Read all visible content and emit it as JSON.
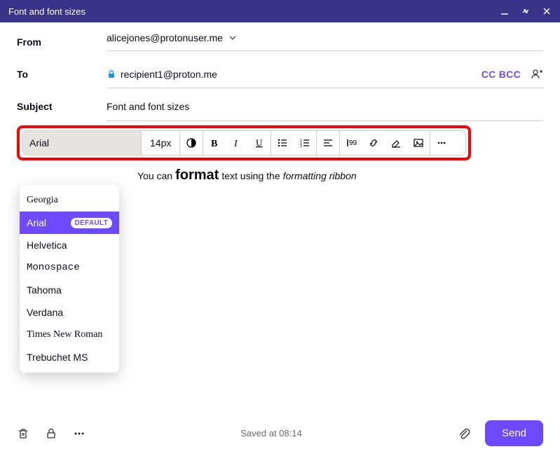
{
  "window": {
    "title": "Font and font sizes"
  },
  "fields": {
    "from": {
      "label": "From",
      "value": "alicejones@protonuser.me"
    },
    "to": {
      "label": "To",
      "value": "recipient1@proton.me",
      "cc_bcc": "CC BCC"
    },
    "subject": {
      "label": "Subject",
      "value": "Font and font sizes"
    }
  },
  "toolbar": {
    "font": "Arial",
    "size": "14px"
  },
  "body": {
    "part1": "You can ",
    "bold": "format",
    "part2": " text using the ",
    "italic": "formatting ribbon"
  },
  "font_dropdown": {
    "default_badge": "DEFAULT",
    "items": [
      {
        "label": "Georgia",
        "css": "font-georgia",
        "selected": false
      },
      {
        "label": "Arial",
        "css": "font-arial",
        "selected": true,
        "default": true
      },
      {
        "label": "Helvetica",
        "css": "font-helvetica",
        "selected": false
      },
      {
        "label": "Monospace",
        "css": "font-monospace",
        "selected": false
      },
      {
        "label": "Tahoma",
        "css": "font-tahoma",
        "selected": false
      },
      {
        "label": "Verdana",
        "css": "font-verdana",
        "selected": false
      },
      {
        "label": "Times New Roman",
        "css": "font-times",
        "selected": false
      },
      {
        "label": "Trebuchet MS",
        "css": "font-trebuchet",
        "selected": false
      }
    ]
  },
  "footer": {
    "status": "Saved at 08:14",
    "send": "Send"
  }
}
